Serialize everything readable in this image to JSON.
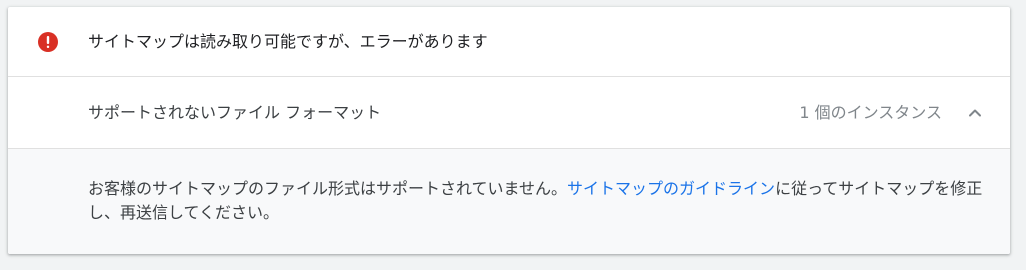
{
  "status": {
    "icon": "error-icon",
    "icon_color": "#d93025",
    "message": "サイトマップは読み取り可能ですが、エラーがあります"
  },
  "issue": {
    "title": "サポートされないファイル フォーマット",
    "count_label": "1 個のインスタンス",
    "toggle_icon": "chevron-up-icon"
  },
  "detail": {
    "text_before": "お客様のサイトマップのファイル形式はサポートされていません。",
    "link_label": "サイトマップのガイドライン",
    "text_after": "に従ってサイトマップを修正し、再送信してください。",
    "link_color": "#1a73e8"
  }
}
